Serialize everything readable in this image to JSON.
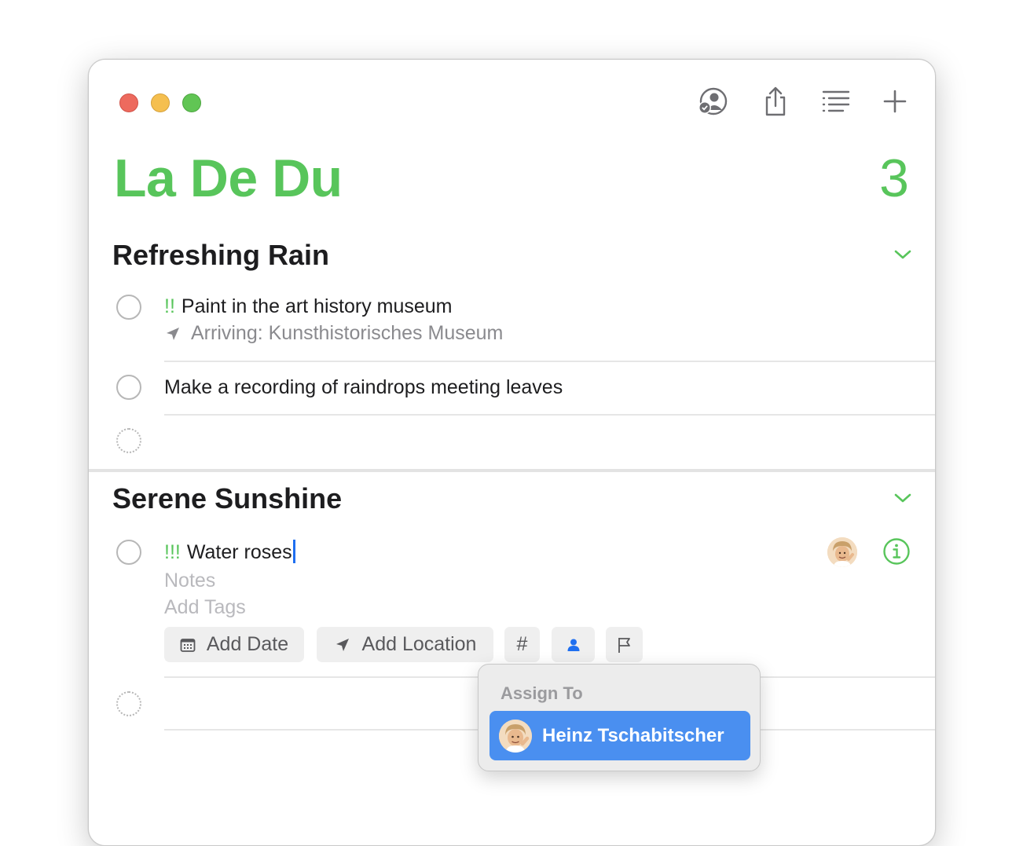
{
  "list": {
    "title": "La De Du",
    "count": "3"
  },
  "toolbar": {
    "icons": [
      "shared-people-icon",
      "share-icon",
      "list-view-icon",
      "plus-icon"
    ]
  },
  "sections": [
    {
      "title": "Refreshing Rain",
      "items": [
        {
          "priority": "!!",
          "title": "Paint in the art history museum",
          "location": "Arriving: Kunsthistorisches Museum"
        },
        {
          "priority": "",
          "title": "Make a recording of raindrops meeting leaves"
        }
      ]
    },
    {
      "title": "Serene Sunshine",
      "items": [
        {
          "priority": "!!!",
          "title": "Water roses",
          "notes_placeholder": "Notes",
          "tags_placeholder": "Add Tags"
        }
      ]
    }
  ],
  "chips": {
    "add_date": "Add Date",
    "add_location": "Add Location",
    "tag_symbol": "#"
  },
  "popover": {
    "header": "Assign To",
    "assignee": "Heinz Tschabitscher"
  },
  "colors": {
    "accent": "#58c55b",
    "selection": "#4a8ff0",
    "caret": "#1f6ff0"
  }
}
